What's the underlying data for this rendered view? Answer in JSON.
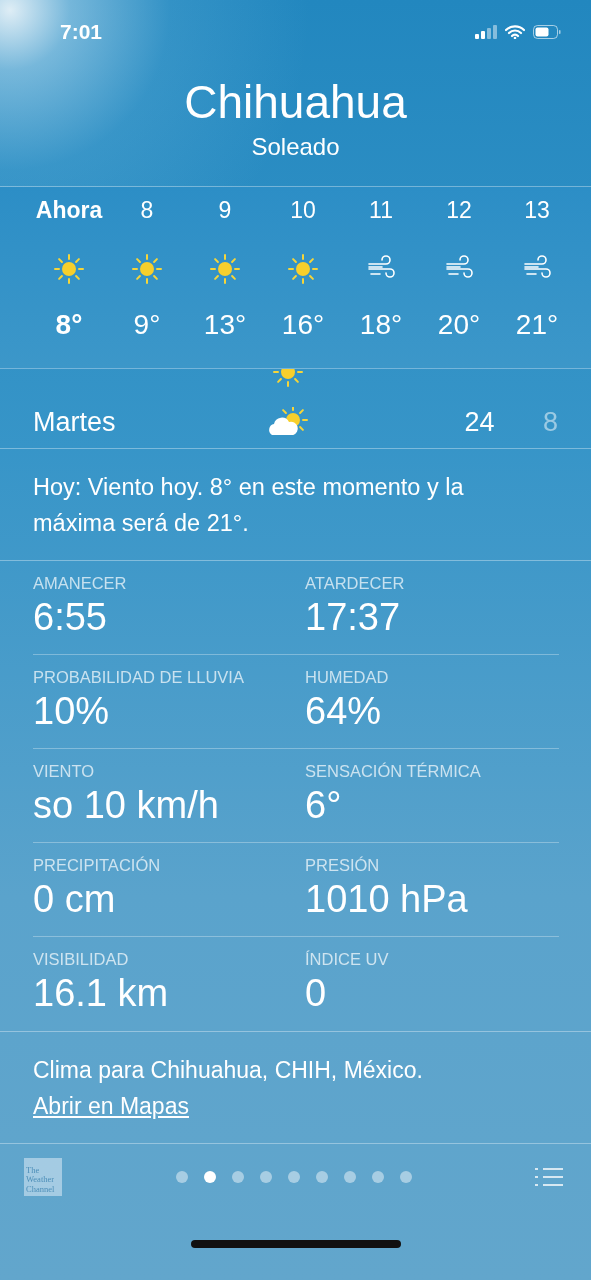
{
  "status_bar": {
    "time": "7:01"
  },
  "header": {
    "city": "Chihuahua",
    "condition": "Soleado"
  },
  "hourly": [
    {
      "time": "Ahora",
      "kind": "sun",
      "temp": "8°",
      "now": true
    },
    {
      "time": "8",
      "kind": "sun",
      "temp": "9°",
      "now": false
    },
    {
      "time": "9",
      "kind": "sun",
      "temp": "13°",
      "now": false
    },
    {
      "time": "10",
      "kind": "sun",
      "temp": "16°",
      "now": false
    },
    {
      "time": "11",
      "kind": "wind",
      "temp": "18°",
      "now": false
    },
    {
      "time": "12",
      "kind": "wind",
      "temp": "20°",
      "now": false
    },
    {
      "time": "13",
      "kind": "wind",
      "temp": "21°",
      "now": false
    }
  ],
  "daily": [
    {
      "kind": "sun"
    },
    {
      "day": "Martes",
      "kind": "cloudsun",
      "high": "24",
      "low": "8"
    }
  ],
  "summary": "Hoy: Viento hoy. 8° en este momento y la máxima será de 21°.",
  "details": [
    {
      "label": "AMANECER",
      "value": "6:55"
    },
    {
      "label": "ATARDECER",
      "value": "17:37"
    },
    {
      "label": "PROBABILIDAD DE LLUVIA",
      "value": "10%"
    },
    {
      "label": "HUMEDAD",
      "value": "64%"
    },
    {
      "label": "VIENTO",
      "value": "so 10 km/h"
    },
    {
      "label": "SENSACIÓN TÉRMICA",
      "value": "6°"
    },
    {
      "label": "PRECIPITACIÓN",
      "value": "0 cm"
    },
    {
      "label": "PRESIÓN",
      "value": "1010 hPa"
    },
    {
      "label": "VISIBILIDAD",
      "value": "16.1 km"
    },
    {
      "label": "ÍNDICE UV",
      "value": "0"
    }
  ],
  "footer": {
    "text": "Clima para Chihuahua, CHIH, México.",
    "link": "Abrir en Mapas"
  },
  "toolbar": {
    "logo_lines": [
      "The",
      "Weather",
      "Channel"
    ],
    "page_dots": [
      {
        "selected": false
      },
      {
        "selected": true
      },
      {
        "selected": false
      },
      {
        "selected": false
      },
      {
        "selected": false
      },
      {
        "selected": false
      },
      {
        "selected": false
      },
      {
        "selected": false
      },
      {
        "selected": false
      }
    ]
  }
}
